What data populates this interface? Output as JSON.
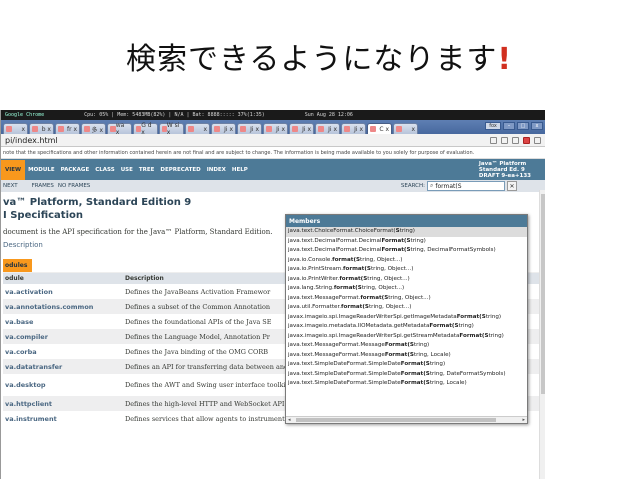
{
  "slide": {
    "title_main": "検索できるようになります",
    "title_mark": "!"
  },
  "status": {
    "app": "Google Chrome",
    "cpu": "Cpu: 05% | Mem: 5483MB(82%) | N/A | Bat: 8888::::: 37%(1:35)",
    "date": "Sun Aug 28 12:06"
  },
  "tabs": [
    {
      "label": "x"
    },
    {
      "label": "b x"
    },
    {
      "label": "fr x"
    },
    {
      "label": "多 x"
    },
    {
      "label": "wa x"
    },
    {
      "label": "G d x"
    },
    {
      "label": "W si x"
    },
    {
      "label": "x"
    },
    {
      "label": "Ji x"
    },
    {
      "label": "Ji x"
    },
    {
      "label": "Ji x"
    },
    {
      "label": "Ji x"
    },
    {
      "label": "Ji x"
    },
    {
      "label": "Ji x"
    },
    {
      "label": "C x"
    },
    {
      "label": "x"
    }
  ],
  "window": {
    "user": "fox",
    "minimize": "–",
    "maximize": "□",
    "close": "x"
  },
  "address": {
    "url": "pi/index.html"
  },
  "notice": "note that the specifications and other information contained herein are not final and are subject to change. The information is being made available to you solely for purpose of evaluation.",
  "nav": {
    "items": [
      "VIEW",
      "MODULE",
      "PACKAGE",
      "CLASS",
      "USE",
      "TREE",
      "DEPRECATED",
      "INDEX",
      "HELP"
    ],
    "brand": [
      "Java™ Platform",
      "Standard Ed. 9",
      "DRAFT 9-ea+133"
    ]
  },
  "subnav": {
    "next": "NEXT",
    "frames": "FRAMES",
    "noframes": "NO FRAMES",
    "search_label": "SEARCH:",
    "search_value": "format(S"
  },
  "doc": {
    "title1": "va™ Platform, Standard Edition 9",
    "title2": "I Specification",
    "desc": "document is the API specification for the Java™ Platform, Standard Edition.",
    "link": "Description"
  },
  "modules": {
    "caption": "odules",
    "col_module": "odule",
    "col_desc": "Description",
    "rows": [
      {
        "name": "va.activation",
        "desc": "Defines the JavaBeans Activation Framewor"
      },
      {
        "name": "va.annotations.common",
        "desc": "Defines a subset of the Common Annotation"
      },
      {
        "name": "va.base",
        "desc": "Defines the foundational APIs of the Java SE"
      },
      {
        "name": "va.compiler",
        "desc": "Defines the Language Model, Annotation Pr"
      },
      {
        "name": "va.corba",
        "desc": "Defines the Java binding of the OMG CORB"
      },
      {
        "name": "va.datatransfer",
        "desc": "Defines an API for transferring data between and within applications."
      },
      {
        "name": "va.desktop",
        "desc": "Defines the AWT and Swing user interface toolkits, plus APIs for accessibility, audio, imaging, printing, and JavaBeans."
      },
      {
        "name": "va.httpclient",
        "desc": "Defines the high-level HTTP and WebSocket API."
      },
      {
        "name": "va.instrument",
        "desc": "Defines services that allow agents to instrument programs running on the JVM."
      }
    ]
  },
  "popup": {
    "header": "Members",
    "items": [
      {
        "pre": "java.text.ChoiceFormat.ChoiceFormat(",
        "b": "S",
        "post": "tring)"
      },
      {
        "pre": "java.text.DecimalFormat.Decimal",
        "b": "Format(S",
        "post": "tring)"
      },
      {
        "pre": "java.text.DecimalFormat.Decimal",
        "b": "Format(S",
        "post": "tring, DecimalFormatSymbols)"
      },
      {
        "pre": "java.io.Console.",
        "b": "format(S",
        "post": "tring, Object...)"
      },
      {
        "pre": "java.io.PrintStream.",
        "b": "format(S",
        "post": "tring, Object...)"
      },
      {
        "pre": "java.io.PrintWriter.",
        "b": "format(S",
        "post": "tring, Object...)"
      },
      {
        "pre": "java.lang.String.",
        "b": "format(S",
        "post": "tring, Object...)"
      },
      {
        "pre": "java.text.MessageFormat.",
        "b": "format(S",
        "post": "tring, Object...)"
      },
      {
        "pre": "java.util.Formatter.",
        "b": "format(S",
        "post": "tring, Object...)"
      },
      {
        "pre": "javax.imageio.spi.ImageReaderWriterSpi.getImageMetadata",
        "b": "Format(S",
        "post": "tring)"
      },
      {
        "pre": "javax.imageio.metadata.IIOMetadata.getMetadata",
        "b": "Format(S",
        "post": "tring)"
      },
      {
        "pre": "javax.imageio.spi.ImageReaderWriterSpi.getStreamMetadata",
        "b": "Format(S",
        "post": "tring)"
      },
      {
        "pre": "java.text.MessageFormat.Message",
        "b": "Format(S",
        "post": "tring)"
      },
      {
        "pre": "java.text.MessageFormat.Message",
        "b": "Format(S",
        "post": "tring, Locale)"
      },
      {
        "pre": "java.text.SimpleDateFormat.SimpleDate",
        "b": "Format(S",
        "post": "tring)"
      },
      {
        "pre": "java.text.SimpleDateFormat.SimpleDate",
        "b": "Format(S",
        "post": "tring, DateFormatSymbols)"
      },
      {
        "pre": "java.text.SimpleDateFormat.SimpleDate",
        "b": "Format(S",
        "post": "tring, Locale)"
      }
    ]
  },
  "colors": {
    "nav_bg": "#4d7a97",
    "nav_active": "#f8981d",
    "tab_bar": "#47689e",
    "accent_red": "#d12f1f"
  }
}
